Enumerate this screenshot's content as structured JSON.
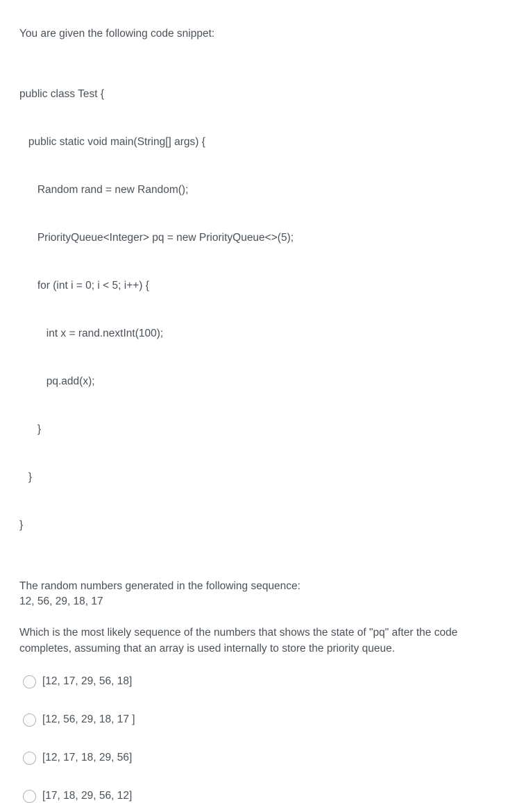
{
  "intro": "You are given the following code snippet:",
  "code": {
    "lines": [
      "public class Test {",
      "   public static void main(String[] args) {",
      "      Random rand = new Random();",
      "      PriorityQueue<Integer> pq = new PriorityQueue<>(5);",
      "      for (int i = 0; i < 5; i++) {",
      "         int x = rand.nextInt(100);",
      "         pq.add(x);",
      "      }",
      "   }",
      "}"
    ]
  },
  "sequence": {
    "caption": "The random numbers generated in the following sequence:",
    "values": "12, 56, 29, 18, 17"
  },
  "question": "Which is the most likely sequence of the numbers that shows the state of \"pq\" after the code completes, assuming that an array is used internally to store the priority queue.",
  "options": [
    {
      "label": "[12, 17, 29, 56, 18]",
      "selected": false
    },
    {
      "label": "[12, 56, 29, 18, 17 ]",
      "selected": false
    },
    {
      "label": "[12, 17, 18, 29, 56]",
      "selected": false
    },
    {
      "label": "[17, 18, 29, 56, 12]",
      "selected": false
    }
  ],
  "colors": {
    "text": "#4a5158",
    "background": "#ffffff",
    "radio_border": "#b4b4b4",
    "radio_fill": "#fbfcfe"
  }
}
